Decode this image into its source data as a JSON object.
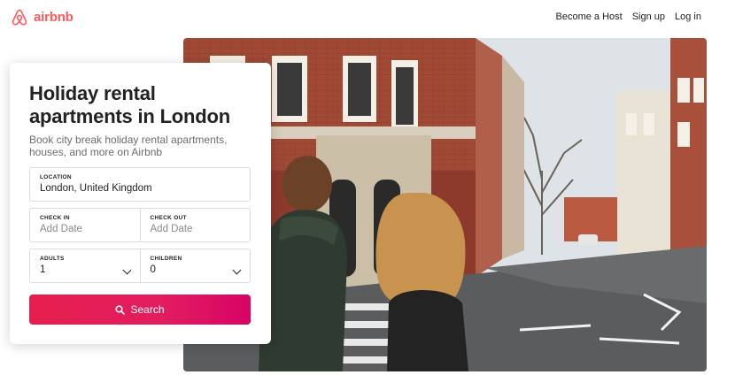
{
  "header": {
    "brand": "airbnb",
    "nav": {
      "become_host": "Become a Host",
      "sign_up": "Sign up",
      "log_in": "Log in"
    }
  },
  "card": {
    "title": "Holiday rental apartments in London",
    "subtitle": "Book city break holiday rental apartments, houses, and more on Airbnb",
    "location": {
      "label": "LOCATION",
      "value": "London, United Kingdom"
    },
    "check_in": {
      "label": "CHECK IN",
      "placeholder": "Add Date"
    },
    "check_out": {
      "label": "CHECK OUT",
      "placeholder": "Add Date"
    },
    "adults": {
      "label": "ADULTS",
      "value": "1"
    },
    "children": {
      "label": "CHILDREN",
      "value": "0"
    },
    "search_label": "Search"
  },
  "colors": {
    "brand": "#ff5a5f",
    "button": "#e31c5f"
  },
  "icons": {
    "logo": "airbnb-belo-icon",
    "search": "search-icon",
    "dropdown": "chevron-down-icon"
  }
}
